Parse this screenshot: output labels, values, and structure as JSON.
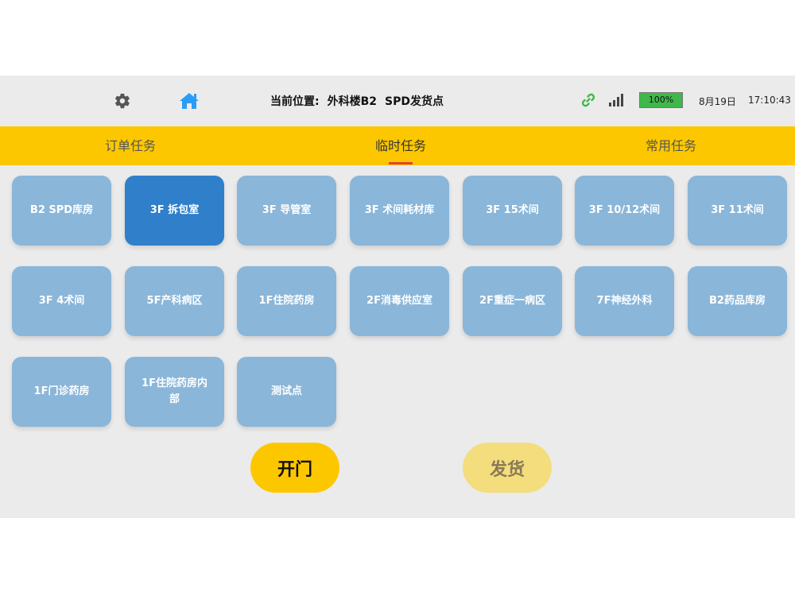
{
  "status_bar": {
    "location_label": "当前位置:",
    "location_value": "外科楼B2",
    "location_point": "SPD发货点",
    "battery": "100%",
    "date": "8月19日",
    "time": "17:10:43"
  },
  "icons": {
    "settings": "gear-icon",
    "home": "home-icon",
    "link": "link-icon",
    "signal": "signal-icon"
  },
  "tabs": [
    {
      "label": "订单任务"
    },
    {
      "label": "临时任务",
      "active": true
    },
    {
      "label": "常用任务"
    }
  ],
  "locations": [
    {
      "label": "B2 SPD库房"
    },
    {
      "label": "3F 拆包室",
      "selected": true
    },
    {
      "label": "3F 导管室"
    },
    {
      "label": "3F 术间耗材库"
    },
    {
      "label": "3F 15术间"
    },
    {
      "label": "3F 10/12术间"
    },
    {
      "label": "3F 11术间"
    },
    {
      "label": "3F 4术间"
    },
    {
      "label": "5F产科病区"
    },
    {
      "label": "1F住院药房"
    },
    {
      "label": "2F消毒供应室"
    },
    {
      "label": "2F重症一病区"
    },
    {
      "label": "7F神经外科"
    },
    {
      "label": "B2药品库房"
    },
    {
      "label": "1F门诊药房"
    },
    {
      "label": "1F住院药房内部"
    },
    {
      "label": "测试点"
    }
  ],
  "actions": {
    "open_label": "开门",
    "ship_label": "发货"
  },
  "colors": {
    "accent_yellow": "#fdc700",
    "tile_blue": "#8ab6d9",
    "tile_selected": "#2f7fca",
    "battery_green": "#3fb84a",
    "home_blue": "#2a9df4",
    "tab_indicator": "#e8403a"
  }
}
